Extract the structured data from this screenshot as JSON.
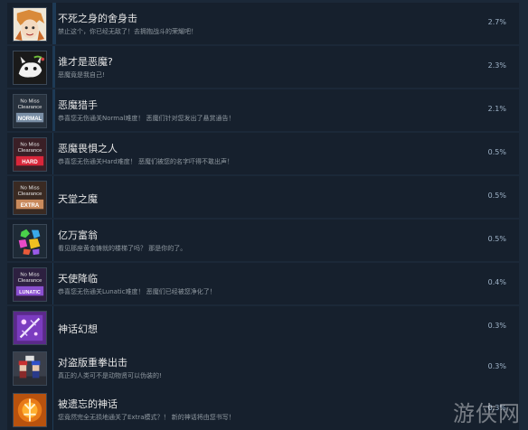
{
  "achievements": [
    {
      "title": "不死之身的舍身击",
      "desc": "禁止这个，你已经无敌了！去拥抱战斗的荣耀吧！",
      "pct": "2.7%",
      "progress": 0.027,
      "icon": "anime-face-icon"
    },
    {
      "title": "谁才是恶魔?",
      "desc": "恶魔竟是我自己!",
      "pct": "2.3%",
      "progress": 0.023,
      "icon": "demon-mask-icon"
    },
    {
      "title": "恶魔猎手",
      "desc": "恭喜您无伤通关Normal难度！ 恶魔们针对您发出了悬赏通告！",
      "pct": "2.1%",
      "progress": 0.021,
      "icon": "no-miss-normal-icon",
      "badge": {
        "line1": "No Miss",
        "line2": "Clearance",
        "mode": "NORMAL"
      }
    },
    {
      "title": "恶魔畏惧之人",
      "desc": "恭喜您无伤通关Hard难度！ 恶魔们被您的名字吓得不敢出声！",
      "pct": "0.5%",
      "progress": 0.005,
      "icon": "no-miss-hard-icon",
      "badge": {
        "line1": "No Miss",
        "line2": "Clearance",
        "mode": "HARD"
      }
    },
    {
      "title": "天堂之魔",
      "desc": "",
      "pct": "0.5%",
      "progress": 0.005,
      "icon": "no-miss-extra-icon",
      "badge": {
        "line1": "No Miss",
        "line2": "Clearance",
        "mode": "EXTRA"
      }
    },
    {
      "title": "亿万富翁",
      "desc": "看见那座黄金铸就的楼梯了吗？ 那是你的了。",
      "pct": "0.5%",
      "progress": 0.005,
      "icon": "gems-icon"
    },
    {
      "title": "天使降临",
      "desc": "恭喜您无伤通关Lunatic难度！ 恶魔们已经被您净化了！",
      "pct": "0.4%",
      "progress": 0.004,
      "icon": "no-miss-lunatic-icon",
      "badge": {
        "line1": "No Miss",
        "line2": "Clearance",
        "mode": "LUNATIC"
      }
    },
    {
      "title": "神话幻想",
      "desc": "",
      "pct": "0.3%",
      "progress": 0.003,
      "icon": "myth-slash-icon"
    },
    {
      "title": "对盗版重拳出击",
      "desc": "真正的人类可不是动物贤可以伪装的!",
      "pct": "0.3%",
      "progress": 0.003,
      "icon": "pixel-characters-icon"
    },
    {
      "title": "被遗忘的神话",
      "desc": "您竟然完全无损地通关了Extra模式？！ 新的神话将由您书写！",
      "pct": "0.3%",
      "progress": 0.003,
      "icon": "forgotten-myth-icon"
    }
  ],
  "watermark": "游侠网",
  "colors": {
    "normal": "#7a8fa6",
    "hard": "#d9263a",
    "extra": "#c98a5c",
    "lunatic": "#8a4fd0"
  }
}
